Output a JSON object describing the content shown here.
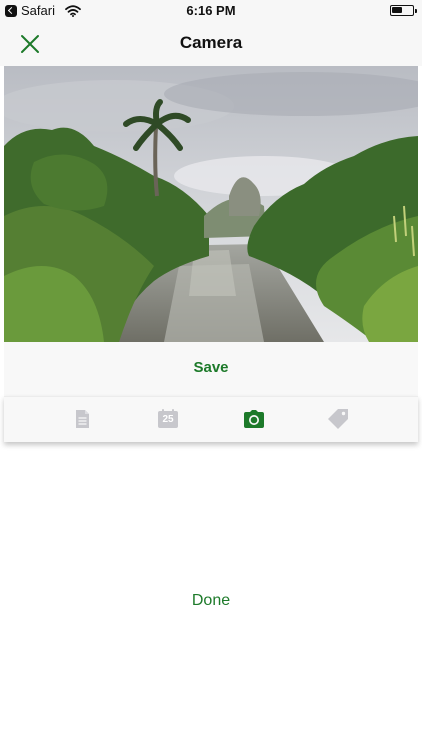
{
  "status_bar": {
    "back_app": "Safari",
    "time": "6:16 PM",
    "battery_level": 0.55
  },
  "nav": {
    "title": "Camera",
    "close_icon": "close-x-icon"
  },
  "actions": {
    "save_label": "Save",
    "done_label": "Done"
  },
  "tabs": [
    {
      "icon": "document-icon",
      "active": false
    },
    {
      "icon": "calendar-icon",
      "label": "25",
      "active": false
    },
    {
      "icon": "camera-icon",
      "active": true
    },
    {
      "icon": "tag-icon",
      "active": false
    }
  ],
  "colors": {
    "accent": "#1d7a2a",
    "inactive_icon": "#c7c7cc"
  }
}
